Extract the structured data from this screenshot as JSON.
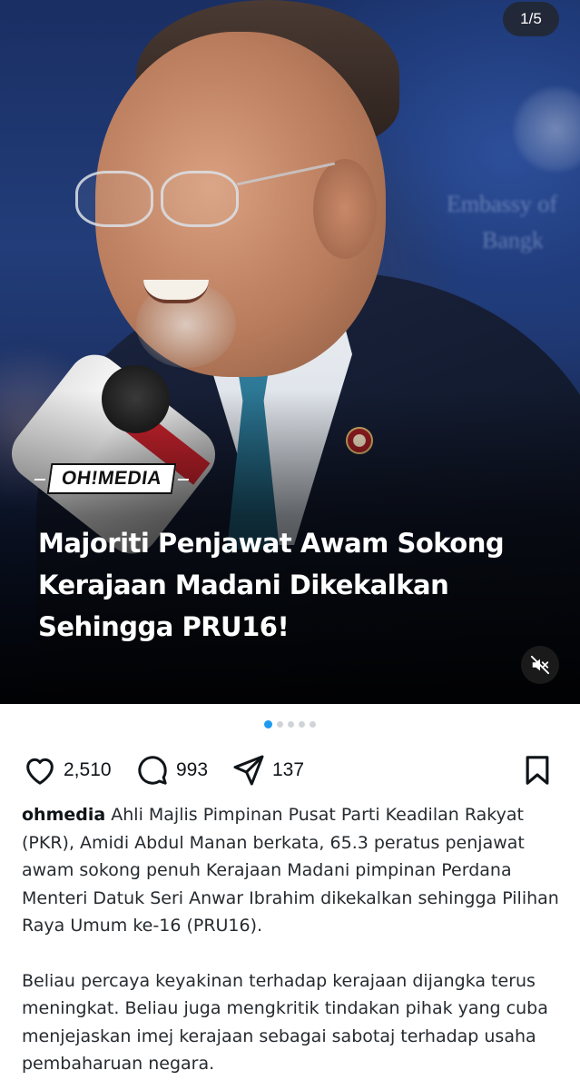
{
  "post": {
    "slide_counter": "1/5",
    "brand_logo": "OH!MEDIA",
    "headline": "Majoriti Penjawat Awam Sokong Kerajaan Madani Dikekalkan Sehingga PRU16!",
    "mute_icon": "speaker-muted-icon",
    "slides": {
      "total": 5,
      "active_index": 0
    }
  },
  "actions": {
    "likes": "2,510",
    "comments": "993",
    "shares": "137",
    "icons": [
      "heart-icon",
      "comment-bubble-icon",
      "send-icon",
      "bookmark-icon"
    ]
  },
  "caption": {
    "username": "ohmedia",
    "paragraph1": "Ahli Majlis Pimpinan Pusat Parti Keadilan Rakyat (PKR), Amidi Abdul Manan berkata, 65.3 peratus penjawat awam sokong penuh Kerajaan Madani pimpinan Perdana Menteri Datuk Seri Anwar Ibrahim dikekalkan sehingga Pilihan Raya Umum ke-16 (PRU16).",
    "paragraph2": "Beliau percaya keyakinan terhadap kerajaan dijangka terus meningkat. Beliau juga mengkritik tindakan pihak yang cuba menjejaskan imej kerajaan sebagai sabotaj terhadap usaha pembaharuan negara."
  },
  "colors": {
    "accent_dot": "#1d9bf0",
    "text": "#0f1419"
  }
}
